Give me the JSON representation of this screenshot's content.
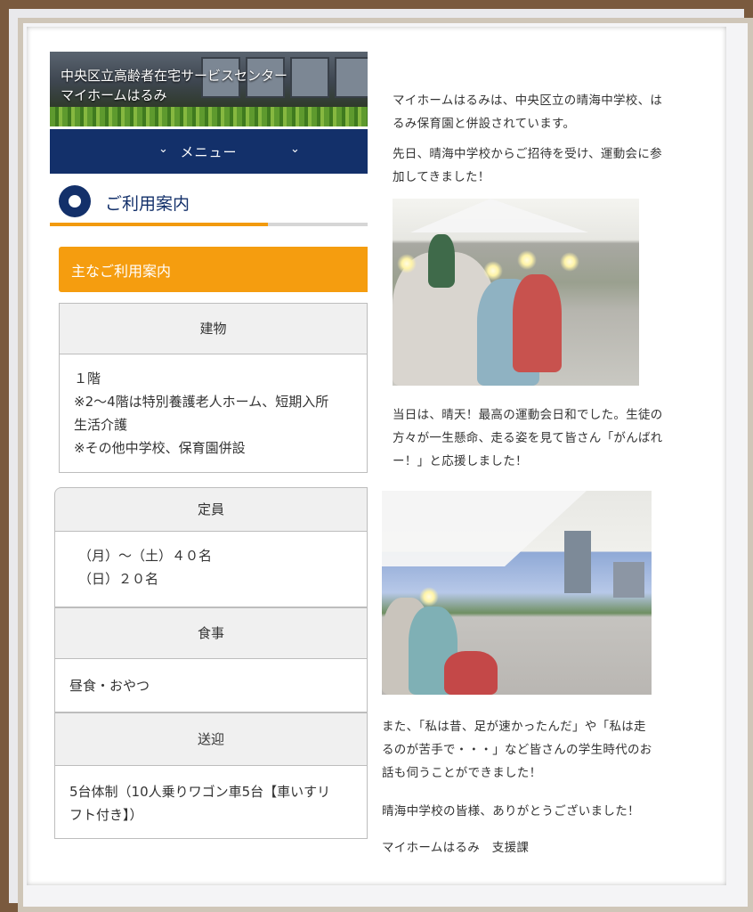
{
  "header": {
    "line1": "中央区立高齢者在宅サービスセンター",
    "line2": "マイホームはるみ"
  },
  "menu": {
    "label": "メニュー"
  },
  "section": {
    "title": "ご利用案内"
  },
  "subheading": "主なご利用案内",
  "table": {
    "building_label": "建物",
    "building_lines": [
      "１階",
      "※2〜4階は特別養護老人ホーム、短期入所",
      "生活介護",
      "※その他中学校、保育園併設"
    ],
    "capacity_label": "定員",
    "capacity_lines": [
      "（月）〜（土）４０名",
      "（日）２０名"
    ],
    "meal_label": "食事",
    "meal_value": "昼食・おやつ",
    "transport_label": "送迎",
    "transport_lines": [
      "5台体制（10人乗りワゴン車5台【車いすリ",
      "フト付き】）"
    ]
  },
  "article": {
    "p1_lines": [
      "マイホームはるみは、中央区立の晴海中学校、は",
      "るみ保育園と併設されています。"
    ],
    "p2_lines": [
      "先日、晴海中学校からご招待を受け、運動会に参",
      "加してきました！"
    ],
    "p3_lines": [
      "当日は、晴天！最高の運動会日和でした。生徒の",
      "方々が一生懸命、走る姿を見て皆さん「がんばれ",
      "ー！」と応援しました！"
    ],
    "p4_lines": [
      "また、「私は昔、足が速かったんだ」や「私は走",
      "るのが苦手で・・・」など皆さんの学生時代のお",
      "話も伺うことができました！"
    ],
    "p5": "晴海中学校の皆様、ありがとうございました！",
    "signature": "マイホームはるみ　支援課"
  },
  "colors": {
    "navy": "#13306a",
    "orange": "#f59d0f",
    "frame": "#7a5a3e"
  }
}
